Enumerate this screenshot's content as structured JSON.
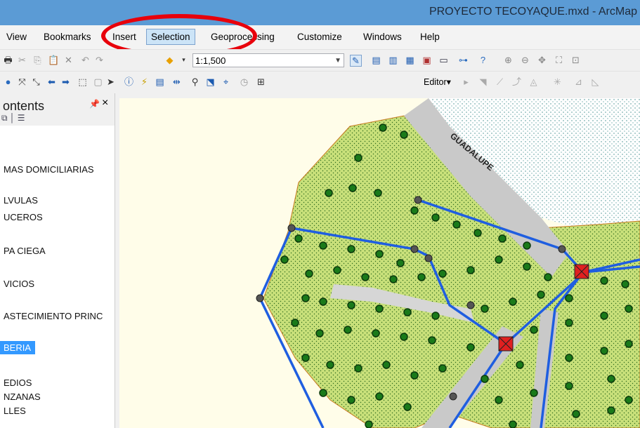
{
  "window": {
    "title": "PROYECTO TECOYAQUE.mxd - ArcMap"
  },
  "menu": [
    "View",
    "Bookmarks",
    "Insert",
    "Selection",
    "Geoprocessing",
    "Customize",
    "Windows",
    "Help"
  ],
  "toolbar": {
    "scale_value": "1:1,500",
    "editor_label": "Editor▾"
  },
  "toc": {
    "title": "ontents",
    "layers": [
      "MAS DOMICILIARIAS",
      "LVULAS",
      "UCEROS",
      "PA CIEGA",
      "VICIOS",
      "ASTECIMIENTO PRINC",
      "BERIA",
      "EDIOS",
      "NZANAS",
      "LLES"
    ],
    "selected_index": 6
  },
  "map": {
    "street_label": "GUADALUPE"
  },
  "colors": {
    "selection_ring": "#e8000b",
    "parcel_fill": "#c8e07a",
    "pipe": "#1f5ee0",
    "road": "#c7c7c7",
    "valve": "#e02020"
  }
}
